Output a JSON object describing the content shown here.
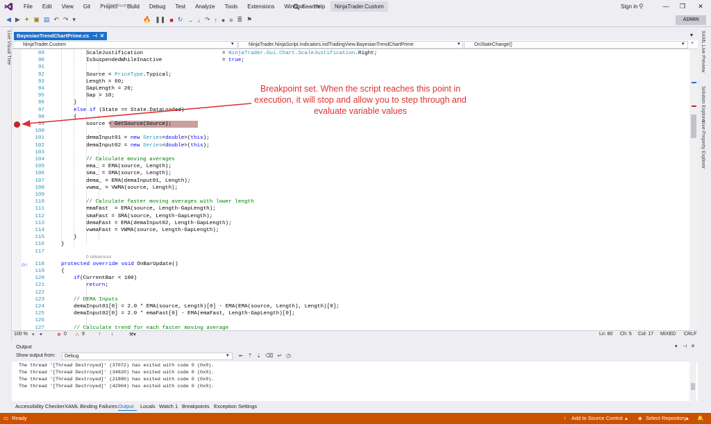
{
  "window": {
    "menu": [
      "File",
      "Edit",
      "View",
      "Git",
      "Project",
      "Build",
      "Debug",
      "Test",
      "Analyze",
      "Tools",
      "Extensions",
      "Window",
      "Help"
    ],
    "search_label": "Search",
    "solution_title": "NinjaTrader.Custom",
    "sign_in": "Sign in",
    "admin": "ADMIN",
    "continue_label": "Continue"
  },
  "doc_tab": "BayesianTrendChartPrime.cs",
  "nav": {
    "project": "NinjaTrader.Custom",
    "class": "NinjaTrader.NinjaScript.Indicators.indTradingView.BayesianTrendChartPrime",
    "member": "OnStateChange()"
  },
  "side_panels": {
    "left": "Live Visual Tree",
    "right": [
      "XAML Live Preview",
      "Solution Explorer",
      "Live Property Explorer"
    ]
  },
  "code_lines": [
    {
      "n": "89",
      "t": "ScaleJustification                         = NinjaTrader.Gui.Chart.ScaleJustification.Right;"
    },
    {
      "n": "90",
      "t": "IsSuspendedWhileInactive                   = true;"
    },
    {
      "n": "91",
      "t": ""
    },
    {
      "n": "92",
      "t": "Source = PriceType.Typical;"
    },
    {
      "n": "93",
      "t": "Length = 60;"
    },
    {
      "n": "94",
      "t": "GapLength = 20;"
    },
    {
      "n": "95",
      "t": "Gap = 10;"
    },
    {
      "n": "96",
      "t": "}"
    },
    {
      "n": "97",
      "t": "else if (State == State.DataLoaded)"
    },
    {
      "n": "98",
      "t": "{"
    },
    {
      "n": "99",
      "t": "source = GetSource(Source);"
    },
    {
      "n": "100",
      "t": ""
    },
    {
      "n": "101",
      "t": "demaInput01 = new Series<double>(this);"
    },
    {
      "n": "102",
      "t": "demaInput02 = new Series<double>(this);"
    },
    {
      "n": "103",
      "t": ""
    },
    {
      "n": "104",
      "t": "// Calculate moving averages"
    },
    {
      "n": "105",
      "t": "ema_ = EMA(source, Length);"
    },
    {
      "n": "106",
      "t": "sma_ = SMA(source, Length);"
    },
    {
      "n": "107",
      "t": "dema_ = EMA(demaInput01, Length);"
    },
    {
      "n": "108",
      "t": "vwma_ = VWMA(source, Length);"
    },
    {
      "n": "109",
      "t": ""
    },
    {
      "n": "110",
      "t": "// Calculate faster moving averages with lower length"
    },
    {
      "n": "111",
      "t": "emaFast  = EMA(source, Length-GapLength);"
    },
    {
      "n": "112",
      "t": "smaFast = SMA(source, Length-GapLength);"
    },
    {
      "n": "113",
      "t": "demaFast = EMA(demaInput02, Length-GapLength);"
    },
    {
      "n": "114",
      "t": "vwmaFast = VWMA(source, Length-GapLength);"
    },
    {
      "n": "115",
      "t": "}"
    },
    {
      "n": "116",
      "t": "}"
    },
    {
      "n": "117",
      "t": ""
    },
    {
      "n": "118",
      "t": "protected override void OnBarUpdate()"
    },
    {
      "n": "119",
      "t": "{"
    },
    {
      "n": "120",
      "t": "if(CurrentBar < 100)"
    },
    {
      "n": "121",
      "t": "return;"
    },
    {
      "n": "122",
      "t": ""
    },
    {
      "n": "123",
      "t": "// DEMA Inputs"
    },
    {
      "n": "124",
      "t": "demaInput01[0] = 2.0 * EMA(source, Length)[0] - EMA(EMA(source, Length), Length)[0];"
    },
    {
      "n": "125",
      "t": "demaInput02[0] = 2.0 * emaFast[0] - EMA(emaFast, Length-GapLength)[0];"
    },
    {
      "n": "126",
      "t": ""
    },
    {
      "n": "127",
      "t": "// Calculate trend for each faster moving average"
    }
  ],
  "codelens": "0 references",
  "annotation": "Breakpoint set. When the script reaches this point in execution, it will stop and allow you to step through and evaluate variable values",
  "editor_status": {
    "zoom": "100 %",
    "errors": "0",
    "warnings": "9",
    "ln": "Ln: 80",
    "ch": "Ch: 5",
    "col": "Col: 17",
    "mode": "MIXED",
    "eol": "CRLF"
  },
  "output": {
    "title": "Output",
    "show_from_label": "Show output from:",
    "source": "Debug",
    "lines": [
      "The thread '[Thread Destroyed]' (37072) has exited with code 0 (0x0).",
      "The thread '[Thread Destroyed]' (34820) has exited with code 0 (0x0).",
      "The thread '[Thread Destroyed]' (21880) has exited with code 0 (0x0).",
      "The thread '[Thread Destroyed]' (42904) has exited with code 0 (0x0)."
    ]
  },
  "bottom_tabs": [
    "Accessibility Checker",
    "XAML Binding Failures",
    "Output",
    "Locals",
    "Watch 1",
    "Breakpoints",
    "Exception Settings"
  ],
  "statusbar": {
    "ready": "Ready",
    "source_control": "Add to Source Control",
    "repository": "Select Repository"
  },
  "colors": {
    "accent": "#1e6fc8",
    "statusbar": "#ca5100",
    "breakpoint": "#c0262c",
    "annotation": "#e03030"
  }
}
